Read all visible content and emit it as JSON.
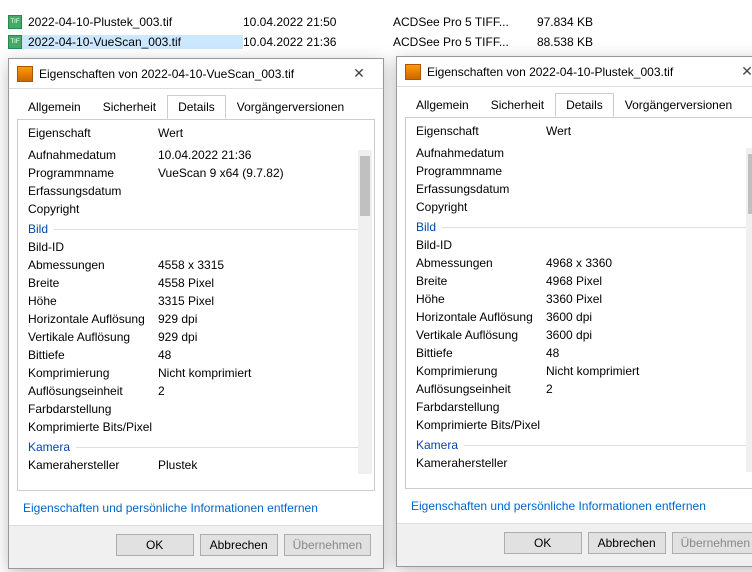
{
  "file_list": {
    "rows": [
      {
        "name": "2022-04-10-Plustek_003.tif",
        "date": "10.04.2022 21:50",
        "type": "ACDSee Pro 5 TIFF...",
        "size": "97.834 KB",
        "selected": false
      },
      {
        "name": "2022-04-10-VueScan_003.tif",
        "date": "10.04.2022 21:36",
        "type": "ACDSee Pro 5 TIFF...",
        "size": "88.538 KB",
        "selected": true
      }
    ]
  },
  "dialogs": [
    {
      "title": "Eigenschaften von 2022-04-10-VueScan_003.tif",
      "tabs": [
        "Allgemein",
        "Sicherheit",
        "Details",
        "Vorgängerversionen"
      ],
      "active_tab": 2,
      "header_prop": "Eigenschaft",
      "header_val": "Wert",
      "props_top": [
        {
          "name": "Aufnahmedatum",
          "value": "10.04.2022 21:36"
        },
        {
          "name": "Programmname",
          "value": "VueScan 9 x64 (9.7.82)"
        },
        {
          "name": "Erfassungsdatum",
          "value": ""
        },
        {
          "name": "Copyright",
          "value": ""
        }
      ],
      "section_bild": "Bild",
      "props_bild": [
        {
          "name": "Bild-ID",
          "value": ""
        },
        {
          "name": "Abmessungen",
          "value": "4558 x 3315"
        },
        {
          "name": "Breite",
          "value": "4558 Pixel"
        },
        {
          "name": "Höhe",
          "value": "3315 Pixel"
        },
        {
          "name": "Horizontale Auflösung",
          "value": "929 dpi"
        },
        {
          "name": "Vertikale Auflösung",
          "value": "929 dpi"
        },
        {
          "name": "Bittiefe",
          "value": "48"
        },
        {
          "name": "Komprimierung",
          "value": "Nicht komprimiert"
        },
        {
          "name": "Auflösungseinheit",
          "value": "2"
        },
        {
          "name": "Farbdarstellung",
          "value": ""
        },
        {
          "name": "Komprimierte Bits/Pixel",
          "value": ""
        }
      ],
      "section_kamera": "Kamera",
      "props_kamera": [
        {
          "name": "Kamerahersteller",
          "value": "Plustek"
        }
      ],
      "remove_link": "Eigenschaften und persönliche Informationen entfernen",
      "btn_ok": "OK",
      "btn_cancel": "Abbrechen",
      "btn_apply": "Übernehmen"
    },
    {
      "title": "Eigenschaften von 2022-04-10-Plustek_003.tif",
      "tabs": [
        "Allgemein",
        "Sicherheit",
        "Details",
        "Vorgängerversionen"
      ],
      "active_tab": 2,
      "header_prop": "Eigenschaft",
      "header_val": "Wert",
      "props_top": [
        {
          "name": "Aufnahmedatum",
          "value": ""
        },
        {
          "name": "Programmname",
          "value": ""
        },
        {
          "name": "Erfassungsdatum",
          "value": ""
        },
        {
          "name": "Copyright",
          "value": ""
        }
      ],
      "section_bild": "Bild",
      "props_bild": [
        {
          "name": "Bild-ID",
          "value": ""
        },
        {
          "name": "Abmessungen",
          "value": "4968 x 3360"
        },
        {
          "name": "Breite",
          "value": "4968 Pixel"
        },
        {
          "name": "Höhe",
          "value": "3360 Pixel"
        },
        {
          "name": "Horizontale Auflösung",
          "value": "3600 dpi"
        },
        {
          "name": "Vertikale Auflösung",
          "value": "3600 dpi"
        },
        {
          "name": "Bittiefe",
          "value": "48"
        },
        {
          "name": "Komprimierung",
          "value": "Nicht komprimiert"
        },
        {
          "name": "Auflösungseinheit",
          "value": "2"
        },
        {
          "name": "Farbdarstellung",
          "value": ""
        },
        {
          "name": "Komprimierte Bits/Pixel",
          "value": ""
        }
      ],
      "section_kamera": "Kamera",
      "props_kamera": [
        {
          "name": "Kamerahersteller",
          "value": ""
        }
      ],
      "remove_link": "Eigenschaften und persönliche Informationen entfernen",
      "btn_ok": "OK",
      "btn_cancel": "Abbrechen",
      "btn_apply": "Übernehmen"
    }
  ]
}
